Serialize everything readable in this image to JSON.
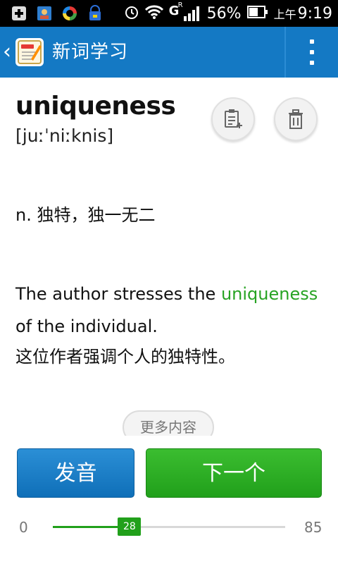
{
  "status_bar": {
    "signal_badge": "G",
    "signal_badge_sup": "R",
    "battery": "56%",
    "time_prefix": "上午",
    "time": "9:19"
  },
  "app_bar": {
    "back_icon": "chevron-left-icon",
    "title": "新词学习",
    "menu_icon": "overflow-menu-icon"
  },
  "word": {
    "term": "uniqueness",
    "phonetic": "[juːˈniːknis]",
    "definition": "n. 独特，独一无二",
    "example_before": "The author stresses the ",
    "example_highlight": "uniqueness",
    "example_after": " of the individual.",
    "example_translation": "这位作者强调个人的独特性。",
    "highlight_color": "#27a323"
  },
  "actions": {
    "add_icon": "add-to-wordbook-icon",
    "delete_icon": "trash-icon",
    "more": "更多内容",
    "speak": "发音",
    "next": "下一个"
  },
  "progress": {
    "min": "0",
    "max": "85",
    "current": "28",
    "fraction": 0.33
  },
  "colors": {
    "app_bar": "#1479c4",
    "primary_button": "#1479c4",
    "next_button": "#21a01b"
  }
}
